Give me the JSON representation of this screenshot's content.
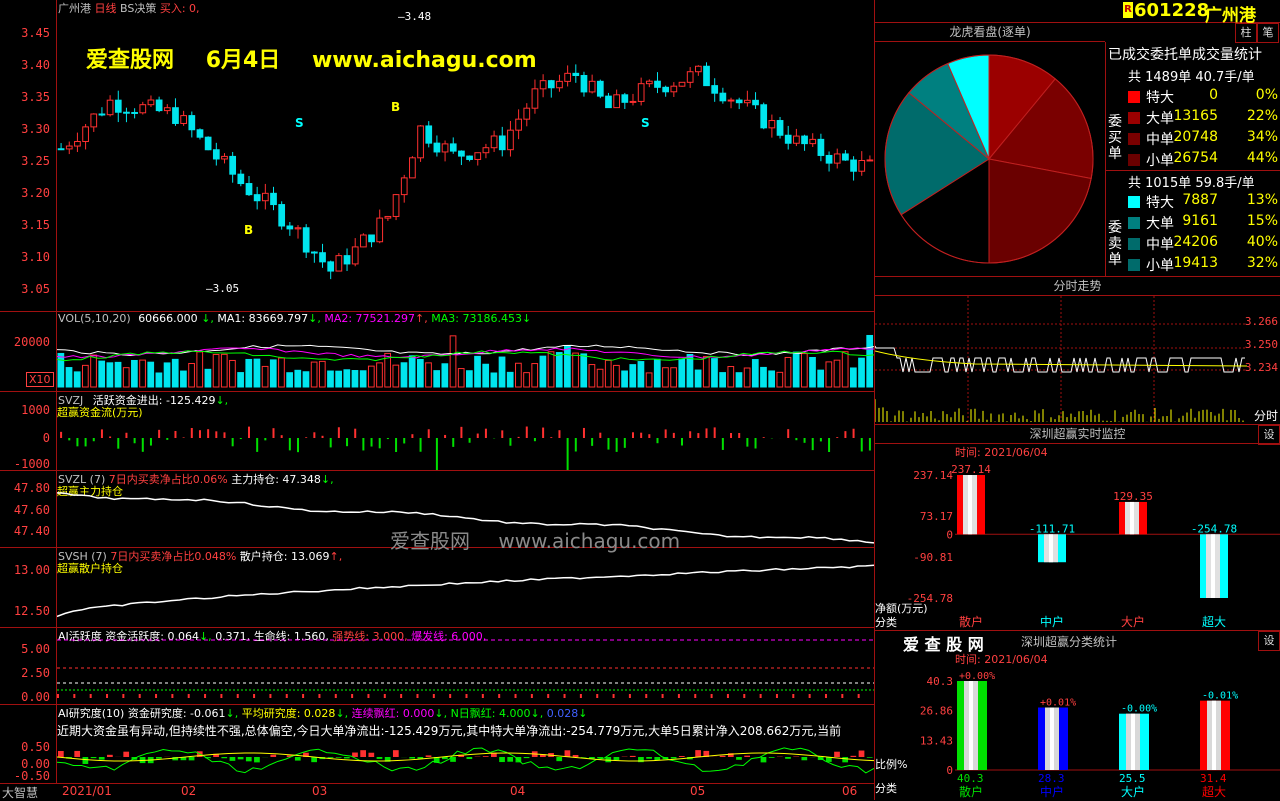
{
  "main": {
    "stock_name": "广州港",
    "period": "日线",
    "indicator": "BS决策",
    "signal_text": "买入: 0,",
    "watermark_site": "爱查股网",
    "watermark_date": "6月4日",
    "watermark_url": "www.aichagu.com",
    "watermark_center": "爱查股网",
    "watermark_center_url": "www.aichagu.com",
    "high_marker": "3.48",
    "low_marker": "3.05",
    "buy_label": "B",
    "sell_label": "S",
    "y_ticks": [
      "3.45",
      "3.40",
      "3.35",
      "3.30",
      "3.25",
      "3.20",
      "3.15",
      "3.10",
      "3.05"
    ],
    "y_range": [
      3.03,
      3.49
    ]
  },
  "vol": {
    "title": "VOL(5,10,20)",
    "value": "60666.000",
    "arrow0": "↓,",
    "ma1": "MA1: 83669.797",
    "ma1_arrow": "↓,",
    "ma2": "MA2: 77521.297",
    "ma2_arrow": "↑,",
    "ma3": "MA3: 73186.453",
    "ma3_arrow": "↓",
    "y_tick": "20000",
    "unit": "X10"
  },
  "svzj": {
    "title": "SVZJ",
    "text": "活跃资金进出: -125.429",
    "arrow": "↓,",
    "sub": "超赢资金流(万元)",
    "y_ticks": [
      "1000",
      "0",
      "-1000"
    ]
  },
  "svzl": {
    "title": "SVZL (7)",
    "text_red": "7日内买卖净占比0.06%",
    "text": "主力持仓: 47.348",
    "arrow": "↓,",
    "sub": "超赢主力持仓",
    "y_ticks": [
      "47.80",
      "47.60",
      "47.40"
    ]
  },
  "svsh": {
    "title": "SVSH (7)",
    "text_red": "7日内买卖净占比0.048%",
    "text": "散户持仓: 13.069",
    "arrow": "↑,",
    "sub": "超赢散户持仓",
    "y_ticks": [
      "13.00",
      "12.50"
    ]
  },
  "ai_act": {
    "title": "AI活跃度 资金活跃度: 0.064",
    "a1": "↓,",
    "v2": "0.371,",
    "v3": "生命线: 1.560,",
    "v4": "强势线: 3.000,",
    "v5": "爆发线: 6.000,",
    "y_ticks": [
      "5.00",
      "2.50",
      "0.00"
    ]
  },
  "ai_res": {
    "title": "AI研究度(10) 资金研究度: -0.061",
    "a1": "↓,",
    "v2": "平均研究度: 0.028",
    "a2": "↓,",
    "v3": "连续飘红: 0.000",
    "a3": "↓,",
    "v4": "N日飘红: 4.000",
    "a4": "↓,",
    "v5": "0.028",
    "a5": "↓",
    "comment": "近期大资金虽有异动,但持续性不强,总体偏空,今日大单净流出:-125.429万元,其中特大单净流出:-254.779万元,大单5日累计净入208.662万元,当前",
    "y_ticks": [
      "0.50",
      "0.00",
      "-0.50"
    ]
  },
  "bottom": {
    "corner": "大智慧",
    "months": [
      "2021/01",
      "02",
      "03",
      "04",
      "05",
      "06"
    ]
  },
  "right": {
    "r_badge": "R",
    "code": "601228",
    "name": "广州港",
    "dragon_title": "龙虎看盘(逐单)",
    "btn_zhu": "柱",
    "btn_bi": "笔",
    "stats_title": "已成交委托单成交量统计",
    "buy_total": "共 1489单 40.7手/单",
    "buy_label": "委买单",
    "sell_total": "共 1015单 59.8手/单",
    "sell_label": "委卖单",
    "buy_rows": [
      {
        "label": "特大",
        "value": "0",
        "pct": "0%"
      },
      {
        "label": "大单",
        "value": "13165",
        "pct": "22%"
      },
      {
        "label": "中单",
        "value": "20748",
        "pct": "34%"
      },
      {
        "label": "小单",
        "value": "26754",
        "pct": "44%"
      }
    ],
    "sell_rows": [
      {
        "label": "特大",
        "value": "7887",
        "pct": "13%"
      },
      {
        "label": "大单",
        "value": "9161",
        "pct": "15%"
      },
      {
        "label": "中单",
        "value": "24206",
        "pct": "40%"
      },
      {
        "label": "小单",
        "value": "19413",
        "pct": "32%"
      }
    ],
    "colors": {
      "buy_xl": "#ff0000",
      "buy_l": "#9b0000",
      "buy_m": "#7a0000",
      "buy_s": "#6a0000",
      "sell_xl": "#00ffff",
      "sell_l": "#008080",
      "sell_m": "#006b6b"
    },
    "intraday_title": "分时走势",
    "intraday_ticks": [
      "3.266",
      "3.250",
      "3.234"
    ],
    "intraday_time": "分时",
    "monitor_title": "深圳超赢实时监控",
    "set_btn": "设",
    "time_label": "时间: 2021/06/04",
    "monitor_ticks": [
      "237.14",
      "73.17",
      "0",
      "-90.81",
      "-254.78"
    ],
    "monitor_bars": [
      {
        "name": "散户",
        "value": 237.14,
        "label": "237.14",
        "color": "#ff0000"
      },
      {
        "name": "中户",
        "value": -111.71,
        "label": "-111.71",
        "color": "#00ffff"
      },
      {
        "name": "大户",
        "value": 129.35,
        "label": "129.35",
        "color": "#ff0000"
      },
      {
        "name": "超大",
        "value": -254.78,
        "label": "-254.78",
        "color": "#00ffff"
      }
    ],
    "monitor_unit": "净额(万元)",
    "category_label": "分类",
    "class_logo": "爱 查 股 网",
    "class_title": "深圳超赢分类统计",
    "class_time": "时间: 2021/06/04",
    "class_ticks": [
      "40.3",
      "26.86",
      "13.43",
      "0"
    ],
    "class_bars": [
      {
        "name": "散户",
        "value": 40.3,
        "top": "+0.00%",
        "bottom": "40.3",
        "color": "#00e000"
      },
      {
        "name": "中户",
        "value": 28.3,
        "top": "+0.01%",
        "bottom": "28.3",
        "color": "#0000ff"
      },
      {
        "name": "大户",
        "value": 25.5,
        "top": "-0.00%",
        "bottom": "25.5",
        "color": "#00ffff"
      },
      {
        "name": "超大",
        "value": 31.4,
        "top": "-0.01%",
        "bottom": "31.4",
        "color": "#ff0000"
      }
    ],
    "ratio_label": "比例%"
  }
}
